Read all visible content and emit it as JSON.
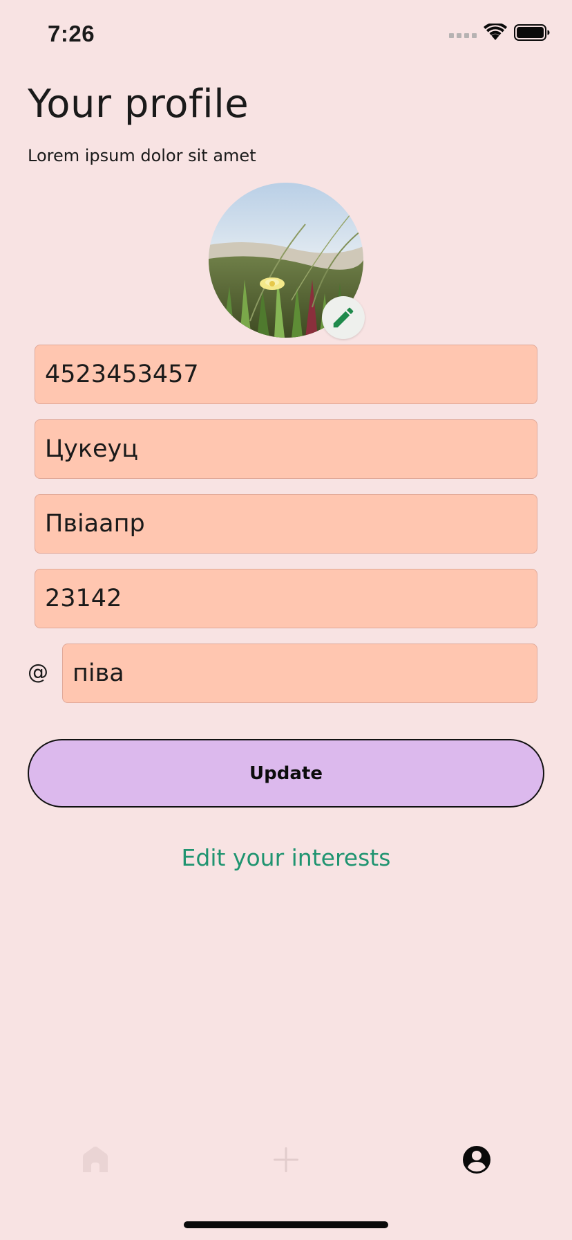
{
  "status_bar": {
    "time": "7:26"
  },
  "header": {
    "title": "Your profile",
    "subtitle": "Lorem ipsum dolor sit amet"
  },
  "form": {
    "field_1": "4523453457",
    "field_2": "Цукеуц",
    "field_3": "Пвіаапр",
    "field_4": "23142",
    "handle_prefix": "@",
    "handle": "піва"
  },
  "actions": {
    "update_label": "Update",
    "interests_label": "Edit your interests"
  },
  "bottom_nav": {
    "items": [
      "home-icon",
      "add-icon",
      "profile-icon"
    ],
    "active": "profile-icon"
  },
  "colors": {
    "background": "#f8e3e3",
    "field_fill": "#ffc6b0",
    "button_fill": "#dcb9ed",
    "link": "#1f9470",
    "edit_icon": "#1f8a4c"
  }
}
